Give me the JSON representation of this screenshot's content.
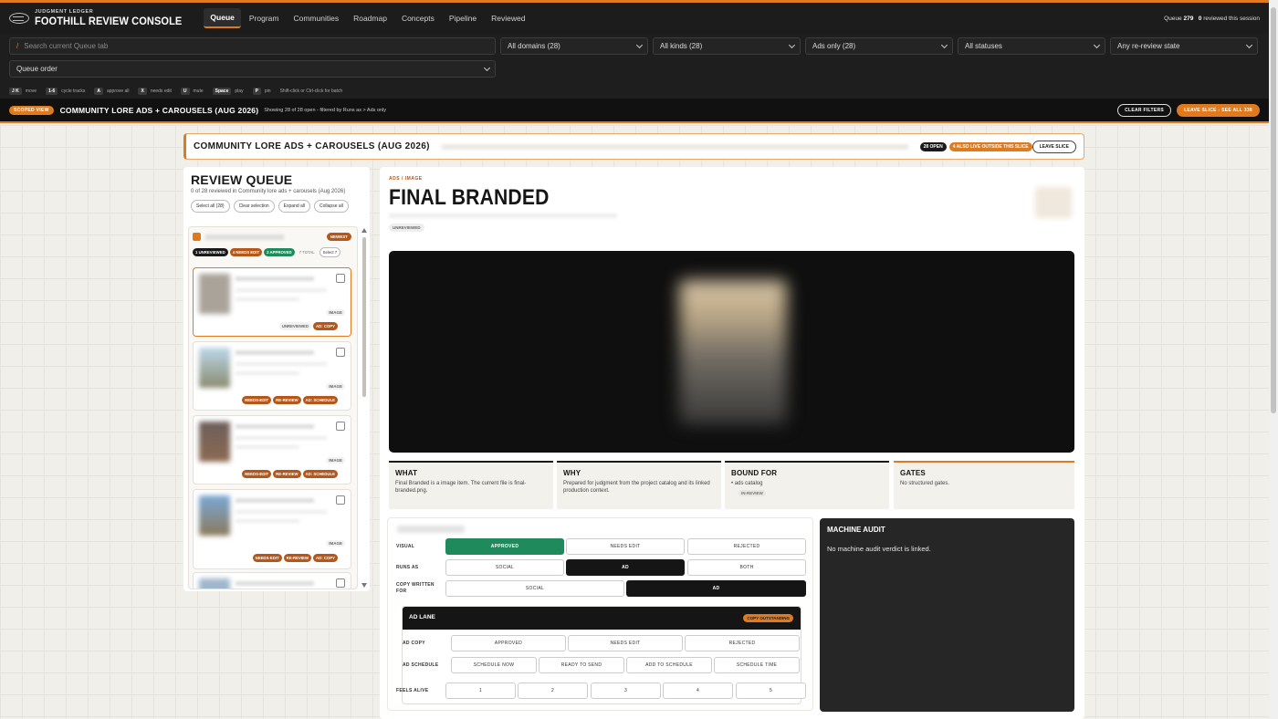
{
  "header": {
    "brand_small": "JUDGMENT LEDGER",
    "brand_title": "FOOTHILL REVIEW CONSOLE",
    "nav": [
      "Queue",
      "Program",
      "Communities",
      "Roadmap",
      "Concepts",
      "Pipeline",
      "Reviewed"
    ],
    "queue_label": "Queue",
    "queue_count": "279",
    "reviewed_count": "0",
    "reviewed_label": "reviewed this session"
  },
  "filters": {
    "search_placeholder": "Search current Queue tab",
    "search_slash": "/",
    "domains": "All domains (28)",
    "kinds": "All kinds (28)",
    "ads": "Ads only (28)",
    "statuses": "All statuses",
    "rereview": "Any re-review state",
    "order": "Queue order"
  },
  "hints": [
    {
      "k": "J K",
      "t": "move"
    },
    {
      "k": "1-6",
      "t": "cycle tracks"
    },
    {
      "k": "A",
      "t": "approve all"
    },
    {
      "k": "X",
      "t": "needs edit"
    },
    {
      "k": "U",
      "t": "mute"
    },
    {
      "k": "Space",
      "t": "play"
    },
    {
      "k": "P",
      "t": "pin"
    }
  ],
  "hints_extra": "Shift-click or Ctrl-click for batch",
  "slice": {
    "scoped": "SCOPED VIEW",
    "title": "COMMUNITY LORE ADS + CAROUSELS (AUG 2026)",
    "sub": "Showing 28 of 28 open - filtered by Runs as > Ads only",
    "clear": "CLEAR FILTERS",
    "leave": "LEAVE SLICE - SEE ALL 338"
  },
  "banner": {
    "title": "COMMUNITY LORE ADS + CAROUSELS (AUG 2026)",
    "open": "28 OPEN",
    "outside": "4 ALSO LIVE OUTSIDE THIS SLICE",
    "leave": "LEAVE SLICE"
  },
  "queue": {
    "title": "REVIEW QUEUE",
    "sub": "0 of 28 reviewed in Community lore ads + carousels (Aug 2026)",
    "buttons": [
      "Select all (28)",
      "Clear selection",
      "Expand all",
      "Collapse all"
    ],
    "newest": "NEWEST",
    "p_unrev": "1 UNREVIEWED",
    "p_edit": "4 NEEDS EDIT",
    "p_appr": "2 APPROVED",
    "total": "7 TOTAL",
    "select": "Select 7",
    "cards": [
      {
        "kind": "IMAGE",
        "tags": [
          "UNREVIEWED",
          "AD: COPY"
        ]
      },
      {
        "kind": "IMAGE",
        "tags": [
          "NEEDS-EDIT",
          "RE-REVIEW",
          "AD: SCHEDULE"
        ]
      },
      {
        "kind": "IMAGE",
        "tags": [
          "NEEDS-EDIT",
          "RE-REVIEW",
          "AD: SCHEDULE"
        ]
      },
      {
        "kind": "IMAGE",
        "tags": [
          "NEEDS-EDIT",
          "RE-REVIEW",
          "AD: COPY"
        ]
      }
    ]
  },
  "detail": {
    "crumb": "ADS / IMAGE",
    "title": "FINAL BRANDED",
    "status": "UNREVIEWED",
    "what_h": "WHAT",
    "what_p": "Final Branded is a image item. The current file is final-branded.png.",
    "why_h": "WHY",
    "why_p": "Prepared for judgment from the project catalog and its linked production context.",
    "bound_h": "BOUND FOR",
    "bound_item": "ads catalog",
    "bound_state": "IN-REVIEW",
    "gates_h": "GATES",
    "gates_p": "No structured gates."
  },
  "review": {
    "visual": "VISUAL",
    "v_opts": [
      "APPROVED",
      "NEEDS EDIT",
      "REJECTED"
    ],
    "runs": "RUNS AS",
    "r_opts": [
      "SOCIAL",
      "AD",
      "BOTH"
    ],
    "copy": "COPY WRITTEN FOR",
    "c_opts": [
      "SOCIAL",
      "AD"
    ],
    "adlane": "AD LANE",
    "outstanding": "COPY OUTSTANDING",
    "adcopy": "AD COPY",
    "ac_opts": [
      "APPROVED",
      "NEEDS EDIT",
      "REJECTED"
    ],
    "adsched": "AD SCHEDULE",
    "as_opts": [
      "SCHEDULE NOW",
      "READY TO SEND",
      "ADD TO SCHEDULE",
      "SCHEDULE TIME"
    ],
    "alive": "FEELS ALIVE",
    "alive_opts": [
      "1",
      "2",
      "3",
      "4",
      "5"
    ]
  },
  "audit": {
    "title": "MACHINE AUDIT",
    "text": "No machine audit verdict is linked."
  }
}
